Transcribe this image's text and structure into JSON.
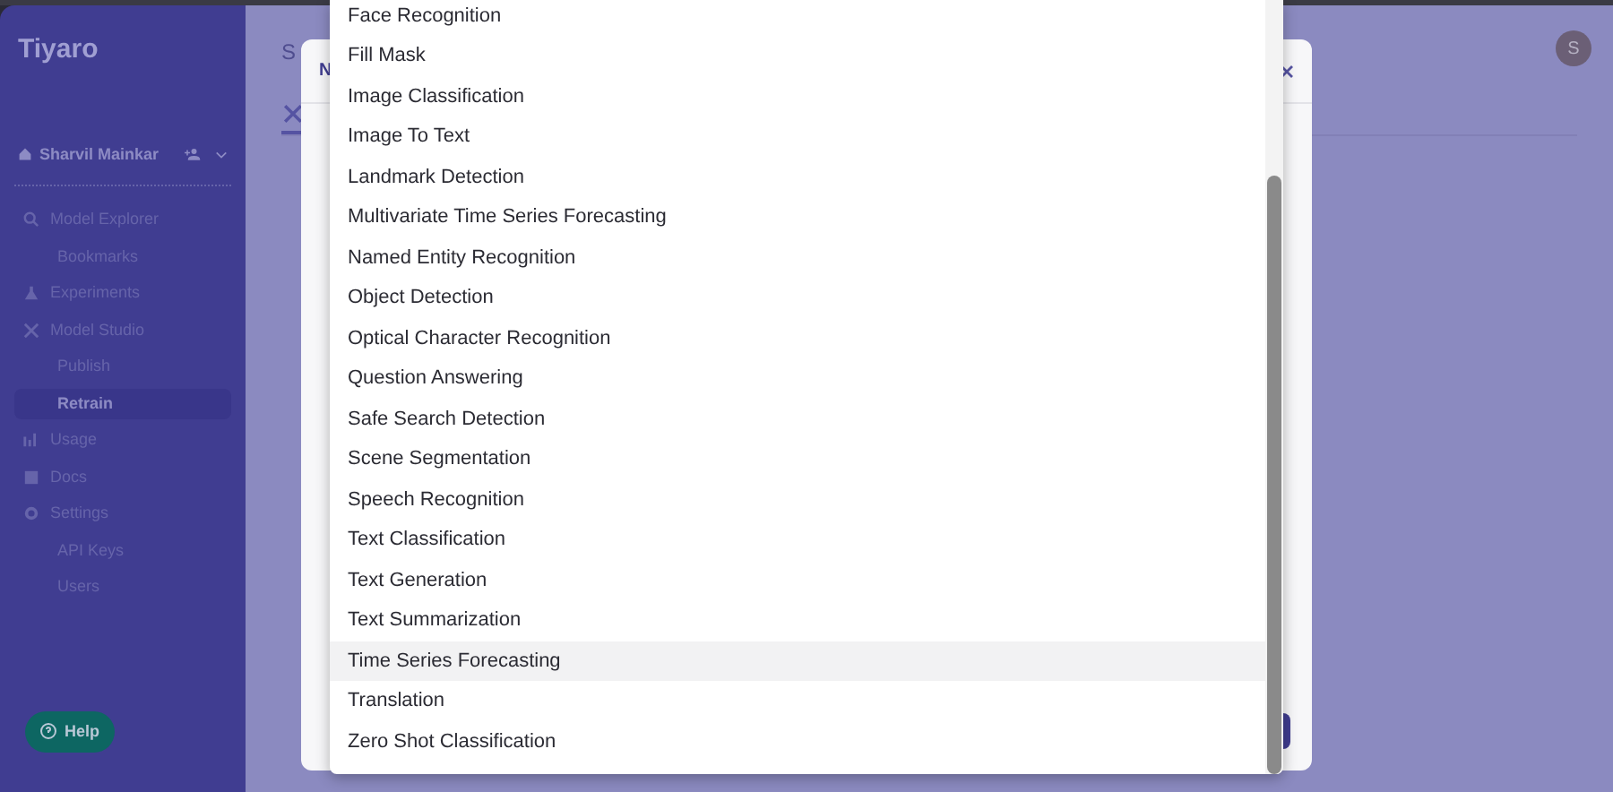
{
  "app": {
    "logo": "Tiyaro",
    "user": "Sharvil Mainkar",
    "avatar": "S"
  },
  "sidebar": {
    "items": [
      {
        "label": "Model Explorer",
        "kind": "search",
        "selected": false
      },
      {
        "label": "Bookmarks",
        "kind": "sub",
        "selected": false
      },
      {
        "label": "Experiments",
        "kind": "flask",
        "selected": false
      },
      {
        "label": "Model Studio",
        "kind": "tools",
        "selected": false
      },
      {
        "label": "Publish",
        "kind": "sub",
        "selected": false
      },
      {
        "label": "Retrain",
        "kind": "sub",
        "selected": true
      },
      {
        "label": "Usage",
        "kind": "chart",
        "selected": false
      },
      {
        "label": "Docs",
        "kind": "doc",
        "selected": false
      },
      {
        "label": "Settings",
        "kind": "gear",
        "selected": false
      },
      {
        "label": "API Keys",
        "kind": "sub",
        "selected": false
      },
      {
        "label": "Users",
        "kind": "sub",
        "selected": false
      }
    ],
    "help": "Help"
  },
  "page": {
    "title": "S"
  },
  "modal": {
    "title": "N"
  },
  "dropdown": {
    "options": [
      {
        "label": "Face Recognition",
        "selected": false
      },
      {
        "label": "Fill Mask",
        "selected": false
      },
      {
        "label": "Image Classification",
        "selected": false
      },
      {
        "label": "Image To Text",
        "selected": false
      },
      {
        "label": "Landmark Detection",
        "selected": false
      },
      {
        "label": "Multivariate Time Series Forecasting",
        "selected": false
      },
      {
        "label": "Named Entity Recognition",
        "selected": false
      },
      {
        "label": "Object Detection",
        "selected": false
      },
      {
        "label": "Optical Character Recognition",
        "selected": false
      },
      {
        "label": "Question Answering",
        "selected": false
      },
      {
        "label": "Safe Search Detection",
        "selected": false
      },
      {
        "label": "Scene Segmentation",
        "selected": false
      },
      {
        "label": "Speech Recognition",
        "selected": false
      },
      {
        "label": "Text Classification",
        "selected": false
      },
      {
        "label": "Text Generation",
        "selected": false
      },
      {
        "label": "Text Summarization",
        "selected": false
      },
      {
        "label": "Time Series Forecasting",
        "selected": true
      },
      {
        "label": "Translation",
        "selected": false
      },
      {
        "label": "Zero Shot Classification",
        "selected": false
      }
    ]
  }
}
